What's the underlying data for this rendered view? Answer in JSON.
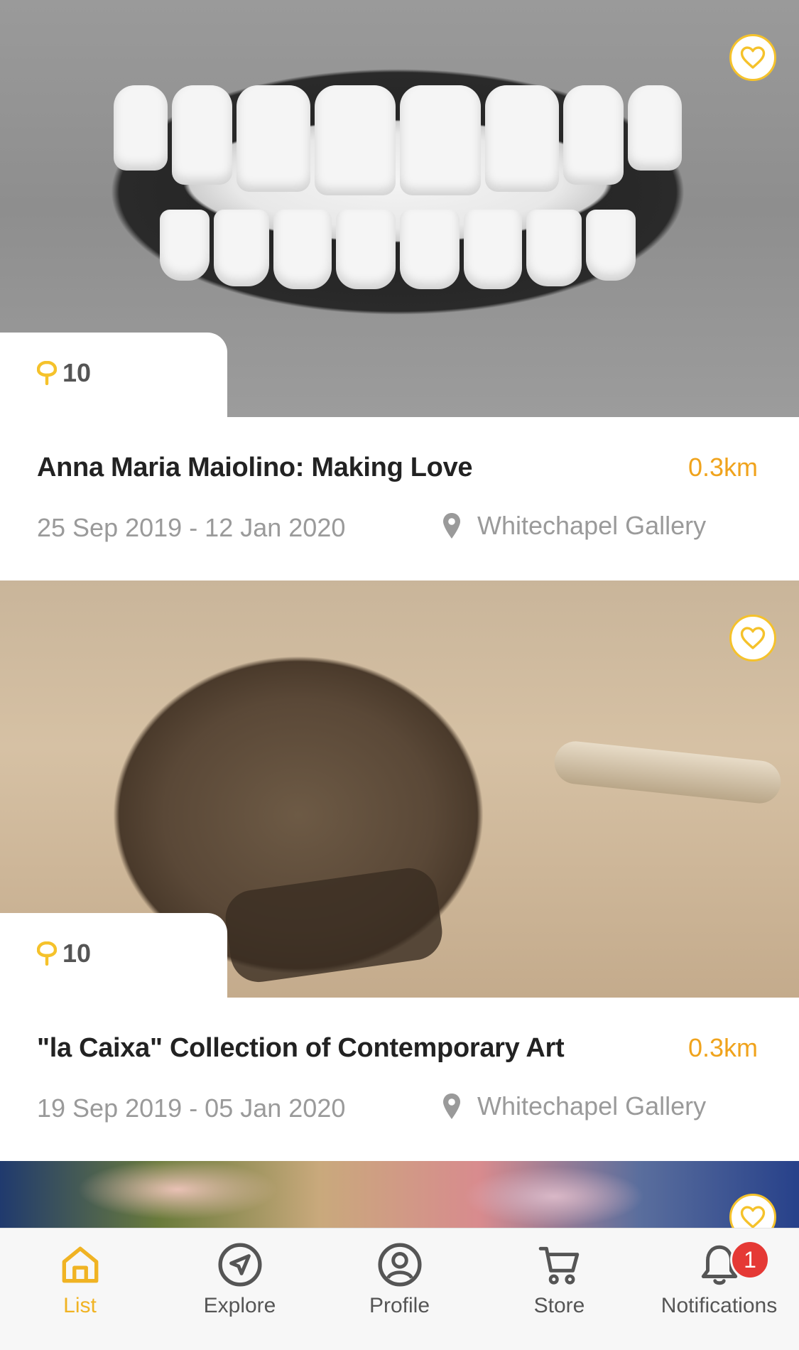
{
  "exhibitions": [
    {
      "points": "10",
      "title": "Anna Maria Maiolino: Making Love",
      "distance": "0.3km",
      "dates": "25 Sep 2019 - 12 Jan 2020",
      "venue": "Whitechapel Gallery",
      "favorite": false
    },
    {
      "points": "10",
      "title": "\"la Caixa\" Collection of Contemporary Art",
      "distance": "0.3km",
      "dates": "19 Sep 2019 - 05 Jan 2020",
      "venue": "Whitechapel Gallery",
      "favorite": false
    }
  ],
  "tabbar": {
    "items": [
      {
        "label": "List",
        "icon": "home-icon",
        "active": true
      },
      {
        "label": "Explore",
        "icon": "navigation-arrow-icon",
        "active": false
      },
      {
        "label": "Profile",
        "icon": "user-circle-icon",
        "active": false
      },
      {
        "label": "Store",
        "icon": "cart-icon",
        "active": false
      },
      {
        "label": "Notifications",
        "icon": "bell-icon",
        "active": false,
        "badge": "1"
      }
    ]
  },
  "colors": {
    "accent": "#f5c22b",
    "distance": "#f0a31c",
    "badge": "#e53935",
    "muted_text": "#9a9a9a"
  }
}
